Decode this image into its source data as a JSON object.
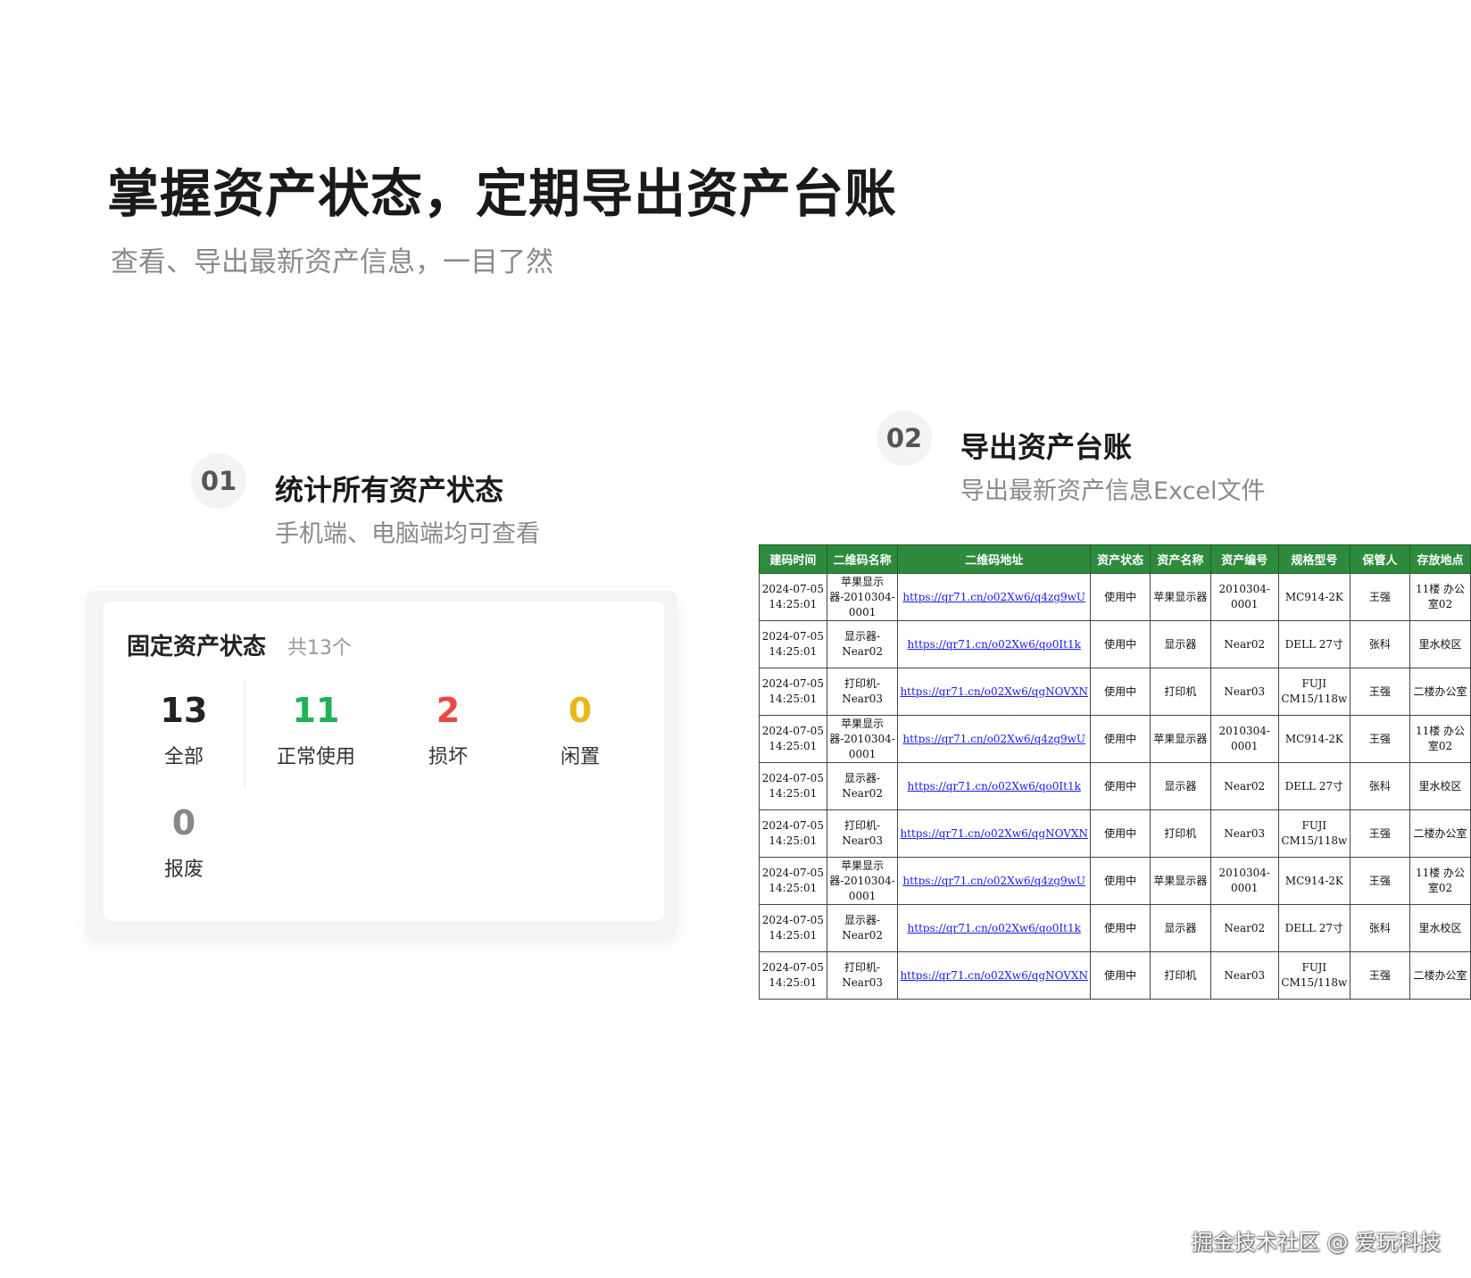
{
  "headline": "掌握资产状态，定期导出资产台账",
  "subline": "查看、导出最新资产信息，一目了然",
  "section1": {
    "num": "01",
    "title": "统计所有资产状态",
    "sub": "手机端、电脑端均可查看"
  },
  "section2": {
    "num": "02",
    "title": "导出资产台账",
    "sub": "导出最新资产信息Excel文件"
  },
  "card": {
    "title": "固定资产状态",
    "count": "共13个",
    "stats": [
      {
        "value": "13",
        "label": "全部",
        "color": "#222222"
      },
      {
        "value": "11",
        "label": "正常使用",
        "color": "#1fb155"
      },
      {
        "value": "2",
        "label": "损坏",
        "color": "#ee4444"
      },
      {
        "value": "0",
        "label": "闲置",
        "color": "#e8b81a"
      },
      {
        "value": "0",
        "label": "报废",
        "color": "#888888"
      }
    ]
  },
  "table": {
    "header_color": "#2e8b3d",
    "headers": [
      "建码时间",
      "二维码名称",
      "二维码地址",
      "资产状态",
      "资产名称",
      "资产编号",
      "规格型号",
      "保管人",
      "存放地点"
    ],
    "rows": [
      [
        "2024-07-05 14:25:01",
        "苹果显示器-2010304-0001",
        "https://qr71.cn/o02Xw6/q4zg9wU",
        "使用中",
        "苹果显示器",
        "2010304-0001",
        "MC914-2K",
        "王强",
        "11楼 办公室02"
      ],
      [
        "2024-07-05 14:25:01",
        "显示器-Near02",
        "https://qr71.cn/o02Xw6/qo0It1k",
        "使用中",
        "显示器",
        "Near02",
        "DELL 27寸",
        "张科",
        "里水校区"
      ],
      [
        "2024-07-05 14:25:01",
        "打印机-Near03",
        "https://qr71.cn/o02Xw6/qgNOVXN",
        "使用中",
        "打印机",
        "Near03",
        "FUJI CM15/118w",
        "王强",
        "二楼办公室"
      ],
      [
        "2024-07-05 14:25:01",
        "苹果显示器-2010304-0001",
        "https://qr71.cn/o02Xw6/q4zg9wU",
        "使用中",
        "苹果显示器",
        "2010304-0001",
        "MC914-2K",
        "王强",
        "11楼 办公室02"
      ],
      [
        "2024-07-05 14:25:01",
        "显示器-Near02",
        "https://qr71.cn/o02Xw6/qo0It1k",
        "使用中",
        "显示器",
        "Near02",
        "DELL 27寸",
        "张科",
        "里水校区"
      ],
      [
        "2024-07-05 14:25:01",
        "打印机-Near03",
        "https://qr71.cn/o02Xw6/qgNOVXN",
        "使用中",
        "打印机",
        "Near03",
        "FUJI CM15/118w",
        "王强",
        "二楼办公室"
      ],
      [
        "2024-07-05 14:25:01",
        "苹果显示器-2010304-0001",
        "https://qr71.cn/o02Xw6/q4zg9wU",
        "使用中",
        "苹果显示器",
        "2010304-0001",
        "MC914-2K",
        "王强",
        "11楼 办公室02"
      ],
      [
        "2024-07-05 14:25:01",
        "显示器-Near02",
        "https://qr71.cn/o02Xw6/qo0It1k",
        "使用中",
        "显示器",
        "Near02",
        "DELL 27寸",
        "张科",
        "里水校区"
      ],
      [
        "2024-07-05 14:25:01",
        "打印机-Near03",
        "https://qr71.cn/o02Xw6/qgNOVXN",
        "使用中",
        "打印机",
        "Near03",
        "FUJI CM15/118w",
        "王强",
        "二楼办公室"
      ]
    ]
  },
  "watermark": "掘金技术社区 @ 爱玩科技"
}
